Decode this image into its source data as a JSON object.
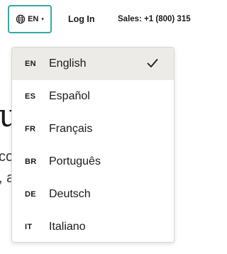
{
  "header": {
    "language_button": {
      "label": "EN",
      "icon": "globe-icon",
      "caret": "▾"
    },
    "login": "Log In",
    "sales": "Sales: +1 (800) 315"
  },
  "background": {
    "heading_fragment": "u",
    "line1_fragment": "co",
    "line2_fragment": ", a"
  },
  "language_menu": {
    "selected": "EN",
    "items": [
      {
        "code": "EN",
        "name": "English"
      },
      {
        "code": "ES",
        "name": "Español"
      },
      {
        "code": "FR",
        "name": "Français"
      },
      {
        "code": "BR",
        "name": "Português"
      },
      {
        "code": "DE",
        "name": "Deutsch"
      },
      {
        "code": "IT",
        "name": "Italiano"
      }
    ],
    "check_icon": "check-icon"
  },
  "colors": {
    "focus_border": "#3aa6a6",
    "selected_background": "#ecebe7"
  }
}
